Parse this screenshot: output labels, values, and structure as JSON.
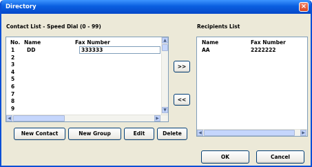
{
  "window": {
    "title": "Directory"
  },
  "contact_list": {
    "label": "Contact List - Speed Dial (0 - 99)",
    "columns": {
      "no": "No.",
      "name": "Name",
      "fax": "Fax Number"
    },
    "rows": [
      {
        "no": "1",
        "name": "DD",
        "fax": "333333"
      },
      {
        "no": "2",
        "name": "",
        "fax": ""
      },
      {
        "no": "3",
        "name": "",
        "fax": ""
      },
      {
        "no": "4",
        "name": "",
        "fax": ""
      },
      {
        "no": "5",
        "name": "",
        "fax": ""
      },
      {
        "no": "6",
        "name": "",
        "fax": ""
      },
      {
        "no": "7",
        "name": "",
        "fax": ""
      },
      {
        "no": "8",
        "name": "",
        "fax": ""
      },
      {
        "no": "9",
        "name": "",
        "fax": ""
      }
    ]
  },
  "recipients": {
    "label": "Recipients List",
    "columns": {
      "name": "Name",
      "fax": "Fax Number"
    },
    "rows": [
      {
        "name": "AA",
        "fax": "2222222"
      }
    ]
  },
  "buttons": {
    "add": ">>",
    "remove": "<<",
    "new_contact": "New Contact",
    "new_group": "New Group",
    "edit": "Edit",
    "delete": "Delete",
    "ok": "OK",
    "cancel": "Cancel"
  },
  "icons": {
    "close": "close-icon",
    "scroll_up": "scroll-up-arrow-icon",
    "scroll_down": "scroll-down-arrow-icon",
    "scroll_left": "scroll-left-arrow-icon",
    "scroll_right": "scroll-right-arrow-icon"
  },
  "colors": {
    "titlebar": "#0a5fe0",
    "dialog": "#ece9d8",
    "button_border": "#003c74",
    "list_border": "#7f9db9"
  }
}
